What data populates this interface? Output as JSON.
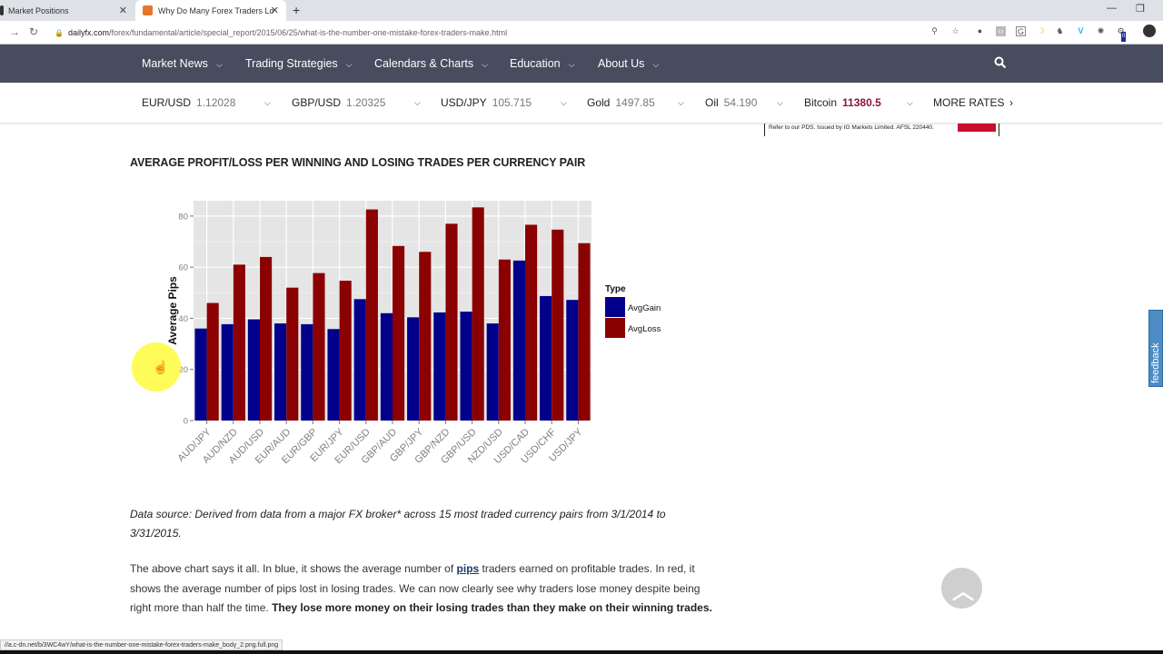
{
  "browser": {
    "tabs": [
      {
        "title": "Market Positions",
        "active": false
      },
      {
        "title": "Why Do Many Forex Traders Lose",
        "active": true
      }
    ],
    "url_host": "dailyfx.com",
    "url_path": "/forex/fundamental/article/special_report/2015/06/25/what-is-the-number-one-mistake-forex-traders-make.html",
    "status_url": "//a.c-dn.net/b/3WC4wY/what-is-the-number-one-mistake-forex-traders-make_body_2.png.full.png",
    "extension_badge": "0"
  },
  "nav": {
    "items": [
      "Market News",
      "Trading Strategies",
      "Calendars & Charts",
      "Education",
      "About Us"
    ]
  },
  "rates": {
    "items": [
      {
        "name": "EUR/USD",
        "value": "1.12028"
      },
      {
        "name": "GBP/USD",
        "value": "1.20325"
      },
      {
        "name": "USD/JPY",
        "value": "105.715"
      },
      {
        "name": "Gold",
        "value": "1497.85"
      },
      {
        "name": "Oil",
        "value": "54.190"
      },
      {
        "name": "Bitcoin",
        "value": "11380.5"
      }
    ],
    "more_label": "MORE RATES"
  },
  "ad": {
    "text": "Refer to our PDS. Issued by IG Markets Limited. AFSL 220440."
  },
  "article": {
    "heading": "AVERAGE PROFIT/LOSS PER WINNING AND LOSING TRADES PER CURRENCY PAIR",
    "caption": "Data source: Derived from data from a major FX broker* across 15 most traded currency pairs from 3/1/2014 to 3/31/2015.",
    "para_1": "The above chart says it all. In blue, it shows the average number of ",
    "para_link": "pips",
    "para_2": " traders earned on profitable trades. In red, it shows the average number of pips lost in losing trades. We can now clearly see why traders lose money despite being right more than half the time. ",
    "para_bold": "They lose more money on their losing trades than they make on their winning trades."
  },
  "feedback_label": "feedback",
  "colors": {
    "nav_bg": "#474c5e",
    "gain": "#00008b",
    "loss": "#8b0000",
    "panel_bg": "#e5e5e5",
    "bitcoin_value": "#8b1538"
  },
  "chart_data": {
    "type": "bar",
    "title": "",
    "xlabel": "",
    "ylabel": "Average Pips",
    "ylim": [
      0,
      86
    ],
    "yticks": [
      0,
      20,
      40,
      60,
      80
    ],
    "grid": true,
    "legend_title": "Type",
    "legend_position": "right",
    "categories": [
      "AUD/JPY",
      "AUD/NZD",
      "AUD/USD",
      "EUR/AUD",
      "EUR/GBP",
      "EUR/JPY",
      "EUR/USD",
      "GBP/AUD",
      "GBP/JPY",
      "GBP/NZD",
      "GBP/USD",
      "NZD/USD",
      "USD/CAD",
      "USD/CHF",
      "USD/JPY"
    ],
    "series": [
      {
        "name": "AvgGain",
        "color": "#00008b",
        "values": [
          36,
          37.7,
          39.6,
          38,
          37.7,
          35.8,
          47.5,
          42,
          40.4,
          42.3,
          42.6,
          38,
          62.6,
          48.7,
          47.2
        ]
      },
      {
        "name": "AvgLoss",
        "color": "#8b0000",
        "values": [
          46,
          61,
          64,
          52,
          57.7,
          54.7,
          82.6,
          68.3,
          66,
          77,
          83.4,
          63,
          76.6,
          74.7,
          69.4
        ]
      }
    ]
  }
}
